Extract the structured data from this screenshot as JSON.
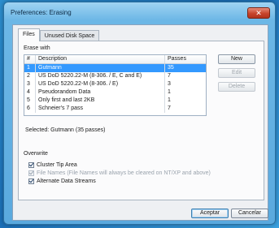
{
  "window": {
    "title": "Preferences: Erasing",
    "close_label": "✕"
  },
  "tabs": [
    {
      "label": "Files",
      "active": true
    },
    {
      "label": "Unused Disk Space",
      "active": false
    }
  ],
  "erase_with": {
    "label": "Erase with",
    "columns": {
      "num": "#",
      "description": "Description",
      "passes": "Passes"
    },
    "rows": [
      {
        "num": "1",
        "description": "Gutmann",
        "passes": "35",
        "selected": true
      },
      {
        "num": "2",
        "description": "US DoD 5220.22-M (8-306. / E, C and E)",
        "passes": "7",
        "selected": false
      },
      {
        "num": "3",
        "description": "US DoD 5220.22-M (8-306. / E)",
        "passes": "3",
        "selected": false
      },
      {
        "num": "4",
        "description": "Pseudorandom Data",
        "passes": "1",
        "selected": false
      },
      {
        "num": "5",
        "description": "Only first and last 2KB",
        "passes": "1",
        "selected": false
      },
      {
        "num": "6",
        "description": "Schneier's 7 pass",
        "passes": "7",
        "selected": false
      }
    ],
    "buttons": {
      "new": "New",
      "edit": "Edit",
      "delete": "Delete"
    },
    "selected_text": "Selected: Gutmann (35 passes)"
  },
  "overwrite": {
    "label": "Overwrite",
    "options": [
      {
        "label": "Cluster Tip Area",
        "checked": true,
        "disabled": false
      },
      {
        "label": "File Names (File Names will always be cleared on NT/XP and above)",
        "checked": true,
        "disabled": true
      },
      {
        "label": "Alternate Data Streams",
        "checked": true,
        "disabled": false
      }
    ]
  },
  "footer": {
    "ok_label": "Aceptar",
    "cancel_label": "Cancelar"
  },
  "colors": {
    "selection": "#3399ff",
    "titlebar": "#6cb7e6",
    "close_button": "#c8452c"
  }
}
